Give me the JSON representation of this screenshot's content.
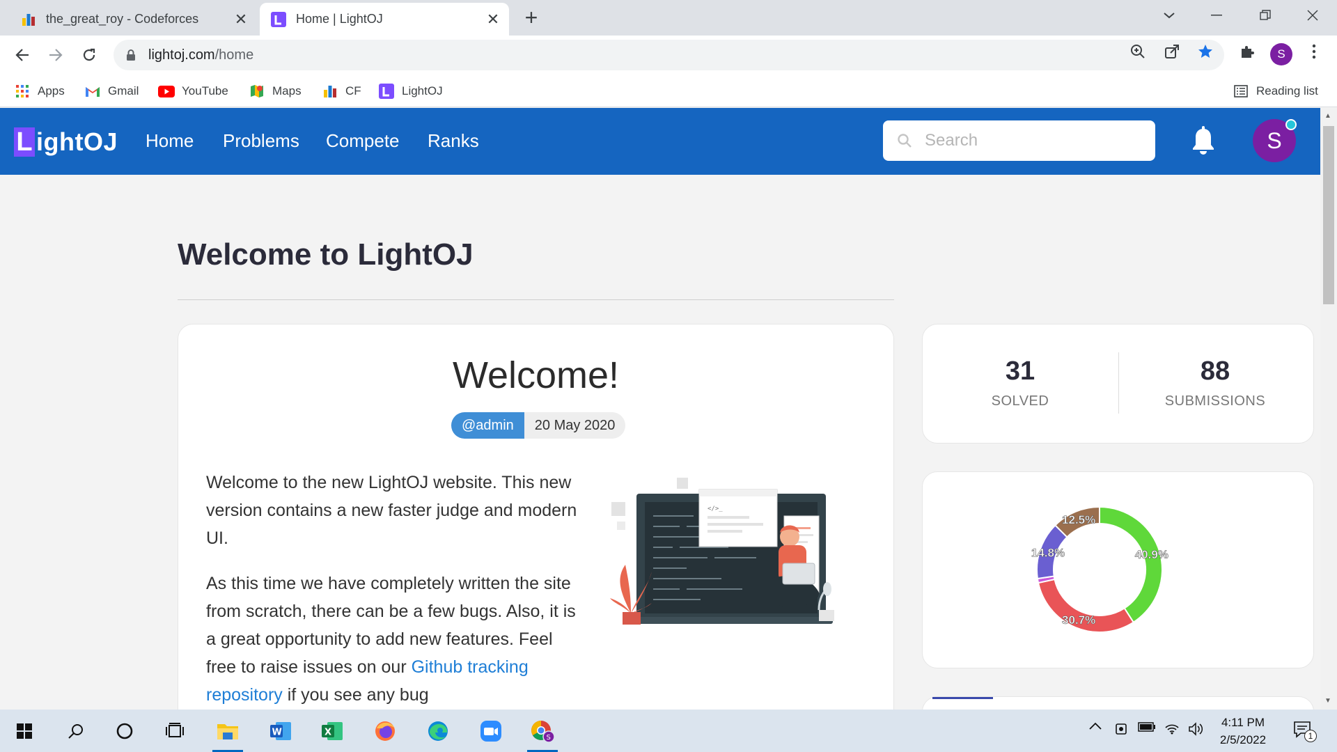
{
  "browser": {
    "tabs": [
      {
        "title": "the_great_roy - Codeforces",
        "icon": "codeforces-icon",
        "active": false
      },
      {
        "title": "Home | LightOJ",
        "icon": "lightoj-icon",
        "active": true
      }
    ],
    "url": {
      "domain": "lightoj.com",
      "path": "/home"
    },
    "profile_initial": "S",
    "bookmarks": [
      {
        "label": "Apps",
        "icon": "apps-grid-icon"
      },
      {
        "label": "Gmail",
        "icon": "gmail-icon"
      },
      {
        "label": "YouTube",
        "icon": "youtube-icon"
      },
      {
        "label": "Maps",
        "icon": "maps-icon"
      },
      {
        "label": "CF",
        "icon": "codeforces-icon"
      },
      {
        "label": "LightOJ",
        "icon": "lightoj-icon"
      }
    ],
    "reading_list": "Reading list"
  },
  "site": {
    "logo_letter": "L",
    "logo_text": "ightOJ",
    "nav": [
      "Home",
      "Problems",
      "Compete",
      "Ranks"
    ],
    "search_placeholder": "Search",
    "avatar_initial": "S",
    "accent": "#1565c0"
  },
  "main": {
    "page_title": "Welcome to LightOJ",
    "post": {
      "title": "Welcome!",
      "author": "@admin",
      "date": "20 May 2020",
      "p1": "Welcome to the new LightOJ website. This new version contains a new faster judge and modern UI.",
      "p2_before": "As this time we have completely written the site from scratch, there can be a few bugs. Also, it is a great opportunity to add new features. Feel free to raise issues on our ",
      "p2_link": "Github tracking repository",
      "p2_after": " if you see any bug"
    }
  },
  "stats": {
    "solved_value": "31",
    "solved_label": "SOLVED",
    "submissions_value": "88",
    "submissions_label": "SUBMISSIONS"
  },
  "chart_data": {
    "type": "pie",
    "donut": true,
    "series": [
      {
        "label": "40.9%",
        "value": 40.9,
        "color": "#5fd83a"
      },
      {
        "label": "30.7%",
        "value": 30.7,
        "color": "#e95457"
      },
      {
        "label": "",
        "value": 1.1,
        "color": "#c957d9"
      },
      {
        "label": "14.8%",
        "value": 14.8,
        "color": "#6a5fd1"
      },
      {
        "label": "12.5%",
        "value": 12.5,
        "color": "#9b6f4e"
      }
    ]
  },
  "taskbar": {
    "apps": [
      "start-icon",
      "search-icon",
      "cortana-icon",
      "task-view-icon",
      "file-explorer-icon",
      "word-icon",
      "excel-icon",
      "firefox-icon",
      "edge-icon",
      "zoom-icon",
      "chrome-icon"
    ],
    "time": "4:11 PM",
    "date": "2/5/2022",
    "notification_count": "1"
  }
}
